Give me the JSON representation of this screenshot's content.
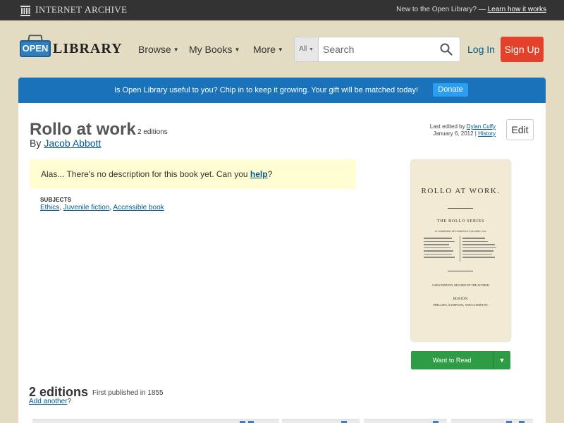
{
  "ia_bar": {
    "brand": "Internet Archive",
    "brand_first": "I",
    "brand_rest1": "NTERNET ",
    "brand_a": "A",
    "brand_rest2": "RCHIVE",
    "new_text": "New to the Open Library? —",
    "learn_link": "Learn how it works"
  },
  "header": {
    "logo_open": "OPEN",
    "logo_library": "LIBRARY",
    "nav": [
      {
        "label": "Browse"
      },
      {
        "label": "My Books"
      },
      {
        "label": "More"
      }
    ],
    "search": {
      "category": "All",
      "placeholder": "Search"
    },
    "login": "Log In",
    "signup": "Sign Up"
  },
  "donate": {
    "text": "Is Open Library useful to you? Chip in to keep it growing. Your gift will be matched today!",
    "button": "Donate",
    "color": "#1a73ba"
  },
  "book": {
    "title": "Rollo at work",
    "editions_count": "2 editions",
    "by": "By",
    "author": "Jacob Abbott",
    "last_edited_prefix": "Last edited by",
    "last_editor": "Dylan Cuffy",
    "last_edited_date": "January 6, 2012 |",
    "history": "History",
    "edit": "Edit",
    "no_description": "Alas... There's no description for this book yet. Can you",
    "help": "help",
    "q": "?",
    "subjects_label": "SUBJECTS",
    "subjects": [
      "Ethics",
      "Juvenile fiction",
      "Accessible book"
    ],
    "cover": {
      "title": "ROLLO AT WORK.",
      "series": "THE ROLLO SERIES",
      "series_sub": "IS COMPOSED OF FOURTEEN VOLUMES, VIZ.",
      "edition": "A NEW EDITION, REVISED BY THE AUTHOR.",
      "city": "BOSTON:",
      "publisher": "PHILLIPS, SAMPSON, AND COMPANY."
    },
    "want_to_read": "Want to Read"
  },
  "editions": {
    "heading": "2 editions",
    "first_published": "First published in 1855",
    "add_another": "Add another",
    "q": "?"
  }
}
